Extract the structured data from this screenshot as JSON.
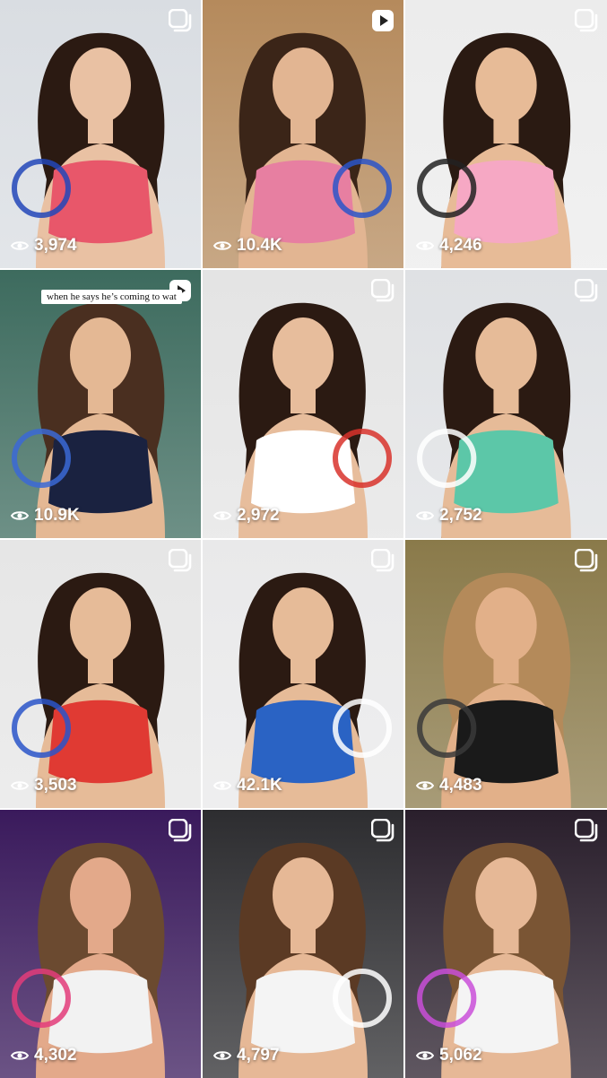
{
  "grid": {
    "tiles": [
      {
        "views": "3,974",
        "type": "carousel",
        "palette": {
          "bg": "#d9dde2",
          "top": "#e8576a",
          "hair": "#2b1a12",
          "skin": "#e9c1a3",
          "accent": "#2247b8"
        }
      },
      {
        "views": "10.4K",
        "type": "reel",
        "palette": {
          "bg": "#b58a5c",
          "top": "#e77fa1",
          "hair": "#3b2518",
          "skin": "#e2b592",
          "accent": "#2a55c9"
        }
      },
      {
        "views": "4,246",
        "type": "carousel",
        "palette": {
          "bg": "#ececec",
          "top": "#f6a8c4",
          "hair": "#2a1a12",
          "skin": "#e7bb97",
          "accent": "#222222"
        }
      },
      {
        "views": "10.9K",
        "type": "reel",
        "caption": "when he says he’s coming to wat",
        "palette": {
          "bg": "#3d6b5e",
          "top": "#1a2240",
          "hair": "#4a2f20",
          "skin": "#e4b894",
          "accent": "#3b68d6"
        }
      },
      {
        "views": "2,972",
        "type": "carousel",
        "palette": {
          "bg": "#e4e4e4",
          "top": "#ffffff",
          "hair": "#2b1a12",
          "skin": "#e7bd9c",
          "accent": "#d8322b"
        }
      },
      {
        "views": "2,752",
        "type": "carousel",
        "palette": {
          "bg": "#dfe1e4",
          "top": "#5cc7a8",
          "hair": "#2b1a12",
          "skin": "#e6bb98",
          "accent": "#ffffff"
        }
      },
      {
        "views": "3,503",
        "type": "carousel",
        "palette": {
          "bg": "#e6e6e6",
          "top": "#e03a33",
          "hair": "#2b1a12",
          "skin": "#e6bb98",
          "accent": "#2a55c9"
        }
      },
      {
        "views": "42.1K",
        "type": "carousel",
        "palette": {
          "bg": "#e9e9ea",
          "top": "#2a63c4",
          "hair": "#2b1a12",
          "skin": "#e6bb98",
          "accent": "#ffffff"
        }
      },
      {
        "views": "4,483",
        "type": "carousel",
        "palette": {
          "bg": "#8a7a4a",
          "top": "#1a1a1a",
          "hair": "#b48a5a",
          "skin": "#e2b089",
          "accent": "#3a3a3a"
        }
      },
      {
        "views": "4,302",
        "type": "carousel",
        "palette": {
          "bg": "#3a1a5c",
          "top": "#f2f2f2",
          "hair": "#6b4a30",
          "skin": "#e3a98a",
          "accent": "#e33c7a"
        }
      },
      {
        "views": "4,797",
        "type": "carousel",
        "palette": {
          "bg": "#2d2d30",
          "top": "#f4f4f4",
          "hair": "#5b3a24",
          "skin": "#e6b896",
          "accent": "#ffffff"
        }
      },
      {
        "views": "5,062",
        "type": "carousel",
        "palette": {
          "bg": "#2a1f2c",
          "top": "#f4f4f4",
          "hair": "#7a5534",
          "skin": "#e6b896",
          "accent": "#c94fd8"
        }
      }
    ]
  },
  "icons": {
    "eye": "eye-icon",
    "carousel": "carousel-icon",
    "reel": "reel-icon"
  }
}
